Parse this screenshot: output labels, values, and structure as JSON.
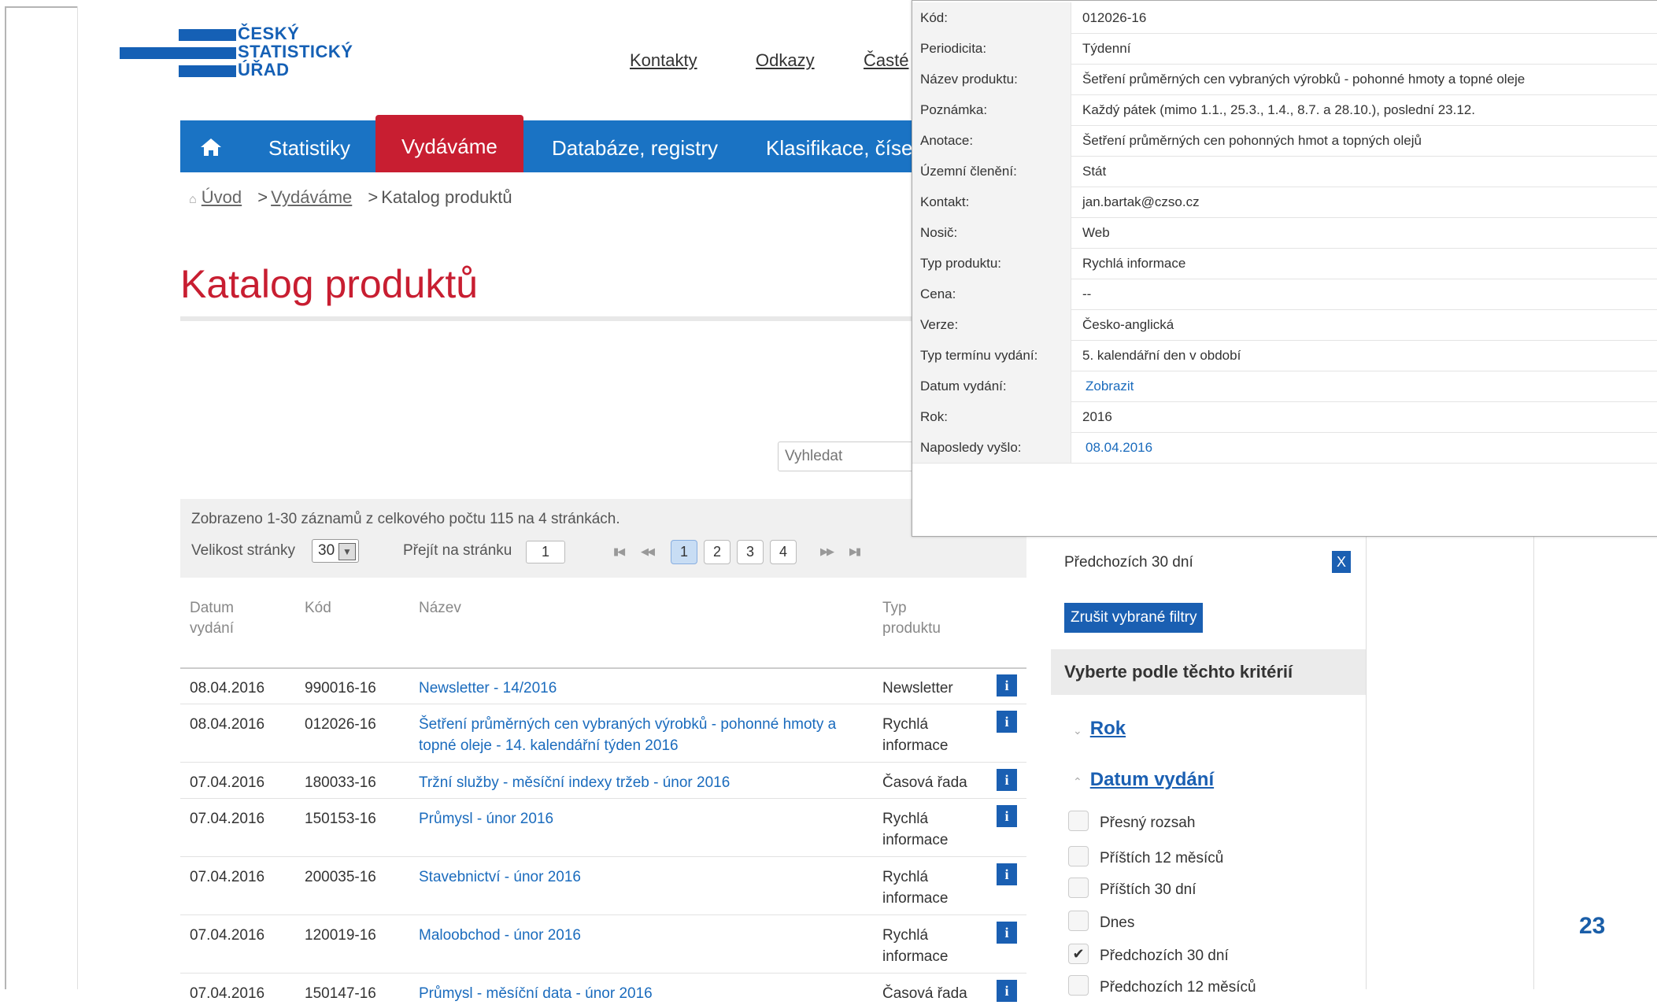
{
  "logo": {
    "lines": [
      "ČESKÝ",
      "STATISTICKÝ",
      "ÚŘAD"
    ]
  },
  "top_links": [
    "Kontakty",
    "Odkazy",
    "Časté"
  ],
  "nav": {
    "items": [
      "Statistiky",
      "Vydáváme",
      "Databáze, registry",
      "Klasifikace, číseln"
    ]
  },
  "breadcrumb": {
    "home": "Úvod",
    "section": "Vydáváme",
    "current": "Katalog produktů"
  },
  "page_title": "Katalog produktů",
  "search": {
    "placeholder": "Vyhledat"
  },
  "paging": {
    "summary": "Zobrazeno 1-30 záznamů z celkového počtu 115 na 4 stránkách.",
    "page_size_label": "Velikost stránky",
    "page_size": "30",
    "goto_label": "Přejít na stránku",
    "goto_value": "1",
    "pages": [
      "1",
      "2",
      "3",
      "4"
    ]
  },
  "table": {
    "headers": {
      "date": "Datum vydání",
      "code": "Kód",
      "name": "Název",
      "type": "Typ produktu"
    },
    "rows": [
      {
        "date": "08.04.2016",
        "code": "990016-16",
        "name": "Newsletter - 14/2016",
        "type": "Newsletter"
      },
      {
        "date": "08.04.2016",
        "code": "012026-16",
        "name": "Šetření průměrných cen vybraných výrobků - pohonné hmoty a topné oleje - 14. kalendářní týden 2016",
        "type": "Rychlá informace"
      },
      {
        "date": "07.04.2016",
        "code": "180033-16",
        "name": "Tržní služby - měsíční indexy tržeb - únor 2016",
        "type": "Časová řada"
      },
      {
        "date": "07.04.2016",
        "code": "150153-16",
        "name": "Průmysl - únor 2016",
        "type": "Rychlá informace"
      },
      {
        "date": "07.04.2016",
        "code": "200035-16",
        "name": "Stavebnictví - únor 2016",
        "type": "Rychlá informace"
      },
      {
        "date": "07.04.2016",
        "code": "120019-16",
        "name": "Maloobchod - únor 2016",
        "type": "Rychlá informace"
      },
      {
        "date": "07.04.2016",
        "code": "150147-16",
        "name": "Průmysl - měsíční data - únor 2016",
        "type": "Časová řada"
      }
    ],
    "info_icon": "i"
  },
  "filter": {
    "active_filter": "Předchozích 30 dní",
    "remove": "X",
    "clear_button": "Zrušit vybrané filtry",
    "criteria_heading": "Vyberte podle těchto kritérií",
    "groups": [
      "Rok",
      "Datum vydání"
    ],
    "options": [
      "Přesný rozsah",
      "Příštích 12 měsíců",
      "Příštích 30 dní",
      "Dnes",
      "Předchozích 30 dní",
      "Předchozích 12 měsíců"
    ],
    "checked_option": "Předchozích 30 dní"
  },
  "popup": {
    "rows": [
      {
        "k": "Kód:",
        "v": "012026-16"
      },
      {
        "k": "Periodicita:",
        "v": "Týdenní"
      },
      {
        "k": "Název produktu:",
        "v": "Šetření průměrných cen vybraných výrobků - pohonné hmoty a topné oleje"
      },
      {
        "k": "Poznámka:",
        "v": "Každý pátek (mimo 1.1., 25.3., 1.4., 8.7. a 28.10.), poslední 23.12."
      },
      {
        "k": "Anotace:",
        "v": "Šetření průměrných cen pohonných hmot a topných olejů"
      },
      {
        "k": "Územní členění:",
        "v": "Stát"
      },
      {
        "k": "Kontakt:",
        "v": "jan.bartak@czso.cz"
      },
      {
        "k": "Nosič:",
        "v": "Web"
      },
      {
        "k": "Typ produktu:",
        "v": "Rychlá informace"
      },
      {
        "k": "Cena:",
        "v": "--"
      },
      {
        "k": "Verze:",
        "v": "Česko-anglická"
      },
      {
        "k": "Typ termínu vydání:",
        "v": "5. kalendářní den v období"
      },
      {
        "k": "Datum vydání:",
        "v": "Zobrazit"
      },
      {
        "k": "Rok:",
        "v": "2016"
      },
      {
        "k": "Naposledy vyšlo:",
        "v": "08.04.2016"
      }
    ]
  },
  "slide_number": "23",
  "colors": {
    "brand_blue": "#1560b5",
    "nav_blue": "#1a73c4",
    "accent_red": "#c81e31",
    "link_blue": "#1a6bbd"
  }
}
